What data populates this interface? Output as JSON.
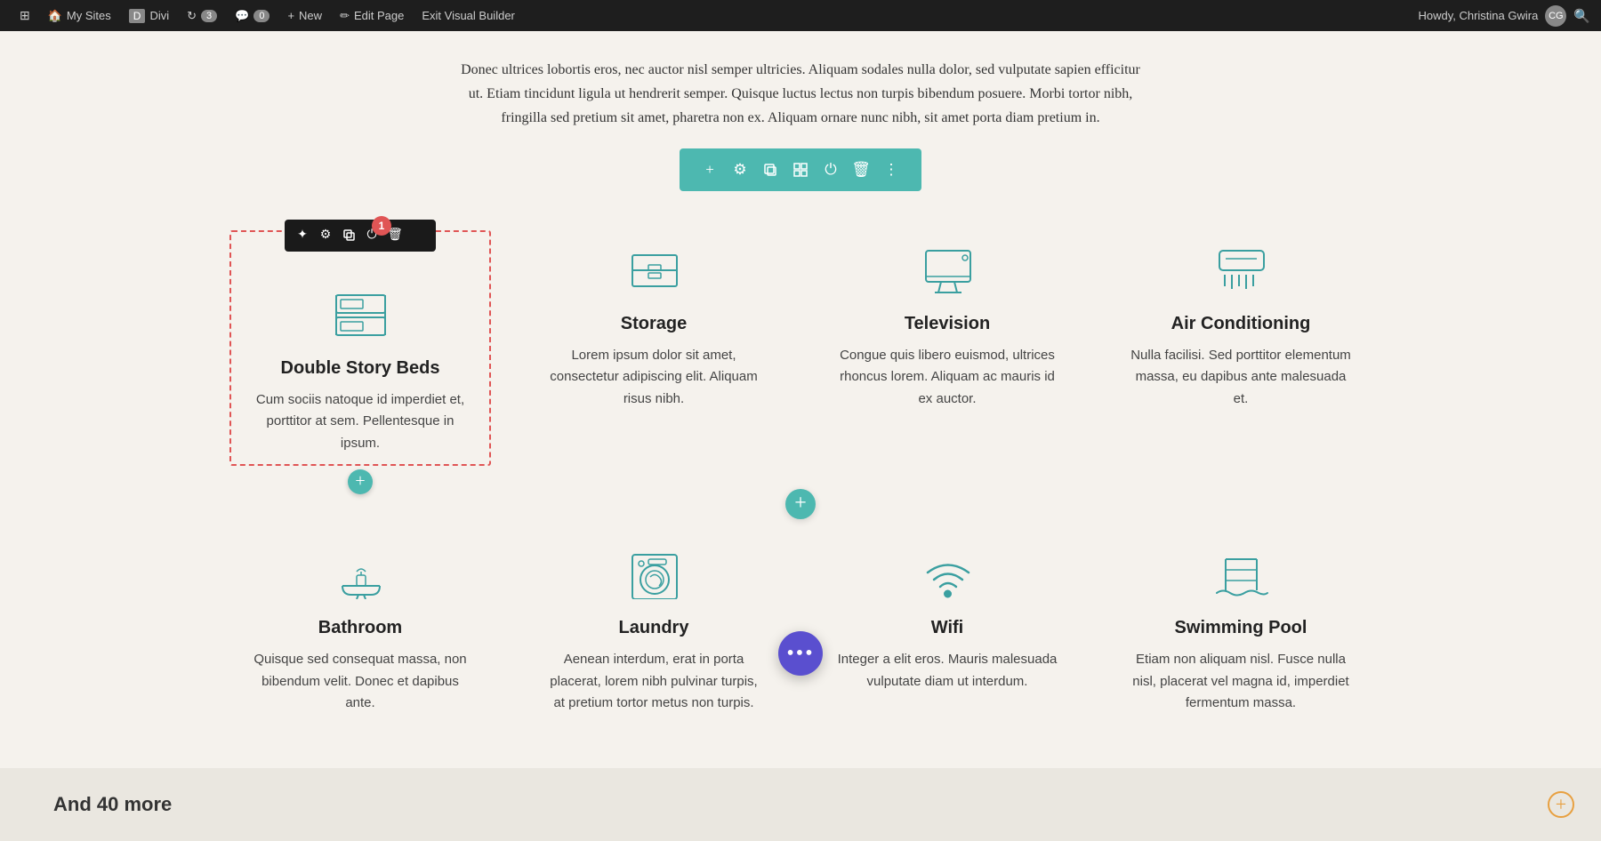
{
  "adminBar": {
    "wpIcon": "⊞",
    "mySites": "My Sites",
    "divi": "Divi",
    "updates": "3",
    "comments": "0",
    "newLabel": "New",
    "editPage": "Edit Page",
    "exitBuilder": "Exit Visual Builder",
    "userGreeting": "Howdy, Christina Gwira"
  },
  "introText": {
    "paragraph": "Donec ultrices lobortis eros, nec auctor nisl semper ultricies. Aliquam sodales nulla dolor, sed vulputate sapien efficitur ut. Etiam tincidunt ligula ut hendrerit semper. Quisque luctus lectus non turpis bibendum posuere. Morbi tortor nibh, fringilla sed pretium sit amet, pharetra non ex. Aliquam ornare nunc nibh, sit amet porta diam pretium in."
  },
  "toolbarStrip": {
    "icons": [
      "+",
      "⚙",
      "⊡",
      "⊞",
      "⏻",
      "🗑",
      "⋮"
    ]
  },
  "featuresRow1": [
    {
      "id": "double-story-beds",
      "title": "Double Story Beds",
      "desc": "Cum sociis natoque id imperdiet et, porttitor at sem. Pellentesque in ipsum.",
      "iconType": "bunk-bed",
      "selected": true
    },
    {
      "id": "storage",
      "title": "Storage",
      "desc": "Lorem ipsum dolor sit amet, consectetur adipiscing elit. Aliquam risus nibh.",
      "iconType": "storage"
    },
    {
      "id": "television",
      "title": "Television",
      "desc": "Congue quis libero euismod, ultrices rhoncus lorem. Aliquam ac mauris id ex auctor.",
      "iconType": "television"
    },
    {
      "id": "air-conditioning",
      "title": "Air Conditioning",
      "desc": "Nulla facilisi. Sed porttitor elementum massa, eu dapibus ante malesuada et.",
      "iconType": "ac"
    }
  ],
  "featuresRow2": [
    {
      "id": "bathroom",
      "title": "Bathroom",
      "desc": "Quisque sed consequat massa, non bibendum velit. Donec et dapibus ante.",
      "iconType": "bathroom"
    },
    {
      "id": "laundry",
      "title": "Laundry",
      "desc": "Aenean interdum, erat in porta placerat, lorem nibh pulvinar turpis, at pretium tortor metus non turpis.",
      "iconType": "laundry"
    },
    {
      "id": "wifi",
      "title": "Wifi",
      "desc": "Integer a elit eros. Mauris malesuada vulputate diam ut interdum.",
      "iconType": "wifi"
    },
    {
      "id": "swimming-pool",
      "title": "Swimming Pool",
      "desc": "Etiam non aliquam nisl. Fusce nulla nisl, placerat vel magna id, imperdiet fermentum massa.",
      "iconType": "pool"
    }
  ],
  "moduleToolbar": {
    "icons": [
      "✦",
      "⚙",
      "⊡",
      "⏻",
      "🗑"
    ],
    "notificationCount": "1"
  },
  "andMore": {
    "text": "And 40 more"
  },
  "colors": {
    "teal": "#4db8b0",
    "darkBg": "#1e1e1e",
    "accentRed": "#e05555",
    "accentPurple": "#5a4fcf",
    "accentOrange": "#e8a040",
    "iconStroke": "#3a9fa0"
  }
}
